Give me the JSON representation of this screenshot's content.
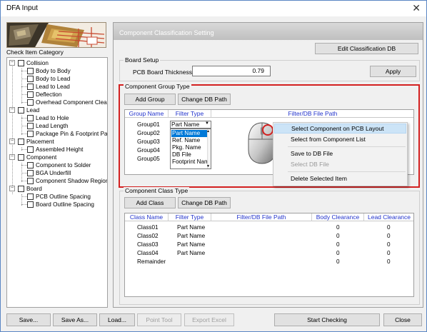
{
  "window": {
    "title": "DFA Input",
    "close_glyph": "✕"
  },
  "left": {
    "category_label": "Check Item Category",
    "tree": [
      {
        "label": "Collision",
        "level": 0,
        "expander": "−"
      },
      {
        "label": "Body to Body",
        "level": 1
      },
      {
        "label": "Body to Lead",
        "level": 1
      },
      {
        "label": "Lead to Lead",
        "level": 1
      },
      {
        "label": "Deflection",
        "level": 1
      },
      {
        "label": "Overhead Component Clearar",
        "level": 1
      },
      {
        "label": "Lead",
        "level": 0,
        "expander": "−"
      },
      {
        "label": "Lead to Hole",
        "level": 1
      },
      {
        "label": "Lead Length",
        "level": 1
      },
      {
        "label": "Package Pin & Footprint Pad",
        "level": 1
      },
      {
        "label": "Placement",
        "level": 0,
        "expander": "−"
      },
      {
        "label": "Assembled Height",
        "level": 1
      },
      {
        "label": "Component",
        "level": 0,
        "expander": "−"
      },
      {
        "label": "Component to Solder",
        "level": 1
      },
      {
        "label": "BGA Underfill",
        "level": 1
      },
      {
        "label": "Component Shadow Region",
        "level": 1
      },
      {
        "label": "Board",
        "level": 0,
        "expander": "−"
      },
      {
        "label": "PCB Outline Spacing",
        "level": 1
      },
      {
        "label": "Board Outline Spacing",
        "level": 1
      }
    ]
  },
  "settings": {
    "header": "Component Classification Setting",
    "edit_button": "Edit Classification DB",
    "board_setup": {
      "title": "Board Setup",
      "thickness_label": "PCB Board Thickness :",
      "thickness_value": "0.79",
      "apply": "Apply"
    },
    "group_type": {
      "title": "Component Group Type",
      "add_button": "Add Group",
      "change_path_button": "Change DB Path",
      "columns": [
        "Group Name",
        "Filter Type",
        "Filter/DB File Path"
      ],
      "rows": [
        "Group01",
        "Group02",
        "Group03",
        "Group04",
        "Group05"
      ],
      "filter_selected": "Part Name",
      "filter_options": [
        "Part Name",
        "Ref. Name",
        "Pkg. Name",
        "DB File",
        "Footprint Nam"
      ]
    },
    "class_type": {
      "title": "Component Class Type",
      "add_button": "Add Class",
      "change_path_button": "Change DB Path",
      "columns": [
        "Class Name",
        "Filter Type",
        "Filter/DB File Path",
        "Body Clearance",
        "Lead Clearance"
      ],
      "rows": [
        {
          "name": "Class01",
          "filter": "Part Name",
          "body": "0",
          "lead": "0"
        },
        {
          "name": "Class02",
          "filter": "Part Name",
          "body": "0",
          "lead": "0"
        },
        {
          "name": "Class03",
          "filter": "Part Name",
          "body": "0",
          "lead": "0"
        },
        {
          "name": "Class04",
          "filter": "Part Name",
          "body": "0",
          "lead": "0"
        },
        {
          "name": "Remainder",
          "filter": "",
          "body": "0",
          "lead": "0"
        }
      ]
    }
  },
  "context_menu": {
    "items": [
      {
        "label": "Select Component on PCB Layout",
        "state": "highlighted"
      },
      {
        "label": "Select from Component List",
        "state": "enabled"
      },
      {
        "label": "Save to DB File",
        "state": "enabled"
      },
      {
        "label": "Select DB File",
        "state": "disabled"
      },
      {
        "label": "Delete Selected Item",
        "state": "enabled"
      }
    ]
  },
  "footer": {
    "save": "Save...",
    "save_as": "Save As...",
    "load": "Load...",
    "point_tool": "Point Tool",
    "export_excel": "Export Excel",
    "start_checking": "Start Checking",
    "close": "Close"
  }
}
